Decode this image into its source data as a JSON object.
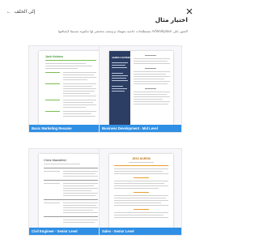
{
  "header": {
    "back_label": "إلى الخلف",
    "back_arrow": "←",
    "close_icon": "close-icon"
  },
  "title": "اختيار مثال",
  "subtitle": "العثور على AI/Workplace مصطلحات خاصة بمهنتك و وصف مختصر لها مكتوبة مسبقا لإضافتها",
  "examples": [
    {
      "label": "Basic Marketing Resume",
      "doc_name": "Jack Holmes"
    },
    {
      "label": "Business Development - Mid Level",
      "doc_name": "JAMES CARTERS"
    },
    {
      "label": "Civil Engineer - Senior Level",
      "doc_name": "Chris Mansfield"
    },
    {
      "label": "Sales - Senior Level",
      "doc_name": "JESS NORRIS"
    }
  ],
  "colors": {
    "accent": "#2f8fe4",
    "label_text": "#ffffff",
    "card_bg": "#f7f7f9",
    "navy_sidebar": "#2c3e63",
    "green_accent": "#7cbf52",
    "orange_accent": "#e8a033"
  }
}
